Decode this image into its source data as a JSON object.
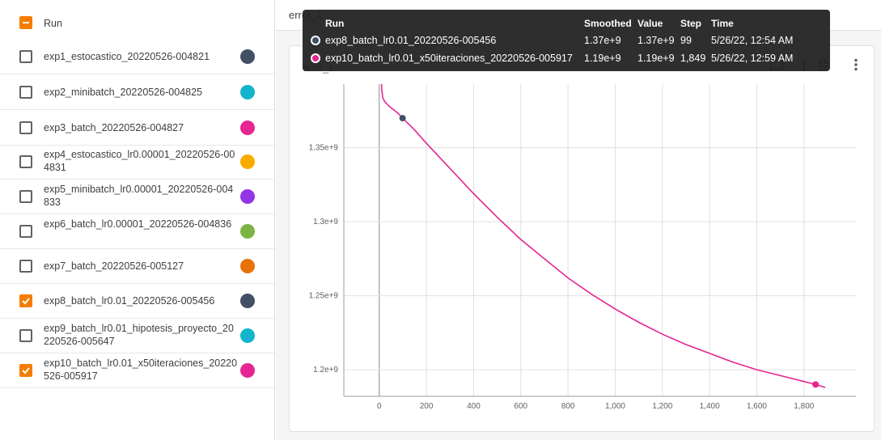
{
  "runs": {
    "header_label": "Run",
    "items": [
      {
        "label": "exp1_estocastico_20220526-004821",
        "checked": false,
        "color": "#425066"
      },
      {
        "label": "exp2_minibatch_20220526-004825",
        "checked": false,
        "color": "#12b5cb"
      },
      {
        "label": "exp3_batch_20220526-004827",
        "checked": false,
        "color": "#e52592"
      },
      {
        "label": "exp4_estocastico_lr0.00001_20220526-004831",
        "checked": false,
        "color": "#f9ab00"
      },
      {
        "label": "exp5_minibatch_lr0.00001_20220526-004833",
        "checked": false,
        "color": "#9334e6"
      },
      {
        "label": "exp6_batch_lr0.00001_20220526-004836",
        "checked": false,
        "color": "#7cb342"
      },
      {
        "label": "exp7_batch_20220526-005127",
        "checked": false,
        "color": "#e8710a"
      },
      {
        "label": "exp8_batch_lr0.01_20220526-005456",
        "checked": true,
        "color": "#425066"
      },
      {
        "label": "exp9_batch_lr0.01_hipotesis_proyecto_20220526-005647",
        "checked": false,
        "color": "#12b5cb"
      },
      {
        "label": "exp10_batch_lr0.01_x50iteraciones_20220526-005917",
        "checked": true,
        "color": "#e52592"
      }
    ]
  },
  "panel": {
    "group_title": "error_1",
    "card_title": "error_1"
  },
  "tooltip": {
    "headers": {
      "run": "Run",
      "smoothed": "Smoothed",
      "value": "Value",
      "step": "Step",
      "time": "Time"
    },
    "rows": [
      {
        "run": "exp8_batch_lr0.01_20220526-005456",
        "smoothed": "1.37e+9",
        "value": "1.37e+9",
        "step": "99",
        "time": "5/26/22, 12:54 AM",
        "color": "#425066"
      },
      {
        "run": "exp10_batch_lr0.01_x50iteraciones_20220526-005917",
        "smoothed": "1.19e+9",
        "value": "1.19e+9",
        "step": "1,849",
        "time": "5/26/22, 12:59 AM",
        "color": "#e52592"
      }
    ]
  },
  "chart_data": {
    "type": "line",
    "title": "",
    "xlabel": "",
    "ylabel": "",
    "xlim": [
      -150,
      2020
    ],
    "ylim": [
      1182000000.0,
      1393000000.0
    ],
    "x_ticks": [
      0,
      200,
      400,
      600,
      800,
      1000,
      1200,
      1400,
      1600,
      1800
    ],
    "x_tick_labels": [
      "0",
      "200",
      "400",
      "600",
      "800",
      "1,000",
      "1,200",
      "1,400",
      "1,600",
      "1,800"
    ],
    "y_ticks": [
      1200000000.0,
      1250000000.0,
      1300000000.0,
      1350000000.0
    ],
    "y_tick_labels": [
      "1.2e+9",
      "1.25e+9",
      "1.3e+9",
      "1.35e+9"
    ],
    "grid": true,
    "series": [
      {
        "color": "#e52592",
        "x": [
          8,
          10,
          15,
          20,
          30,
          50,
          75,
          100,
          150,
          200,
          300,
          400,
          500,
          600,
          700,
          800,
          900,
          1000,
          1100,
          1200,
          1300,
          1400,
          1500,
          1600,
          1700,
          1800,
          1849,
          1890
        ],
        "y": [
          1500000000.0,
          1390000000.0,
          1384000000.0,
          1382000000.0,
          1380000000.0,
          1377000000.0,
          1374000000.0,
          1370000000.0,
          1362000000.0,
          1353000000.0,
          1336000000.0,
          1319000000.0,
          1303000000.0,
          1288000000.0,
          1275000000.0,
          1262000000.0,
          1251000000.0,
          1241000000.0,
          1232000000.0,
          1224000000.0,
          1217000000.0,
          1211000000.0,
          1205000000.0,
          1200000000.0,
          1196000000.0,
          1192000000.0,
          1190000000.0,
          1188000000.0
        ]
      }
    ],
    "highlight_points": [
      {
        "x": 99,
        "y": 1370000000.0,
        "color": "#425066"
      },
      {
        "x": 1849,
        "y": 1190000000.0,
        "color": "#e52592"
      }
    ]
  }
}
